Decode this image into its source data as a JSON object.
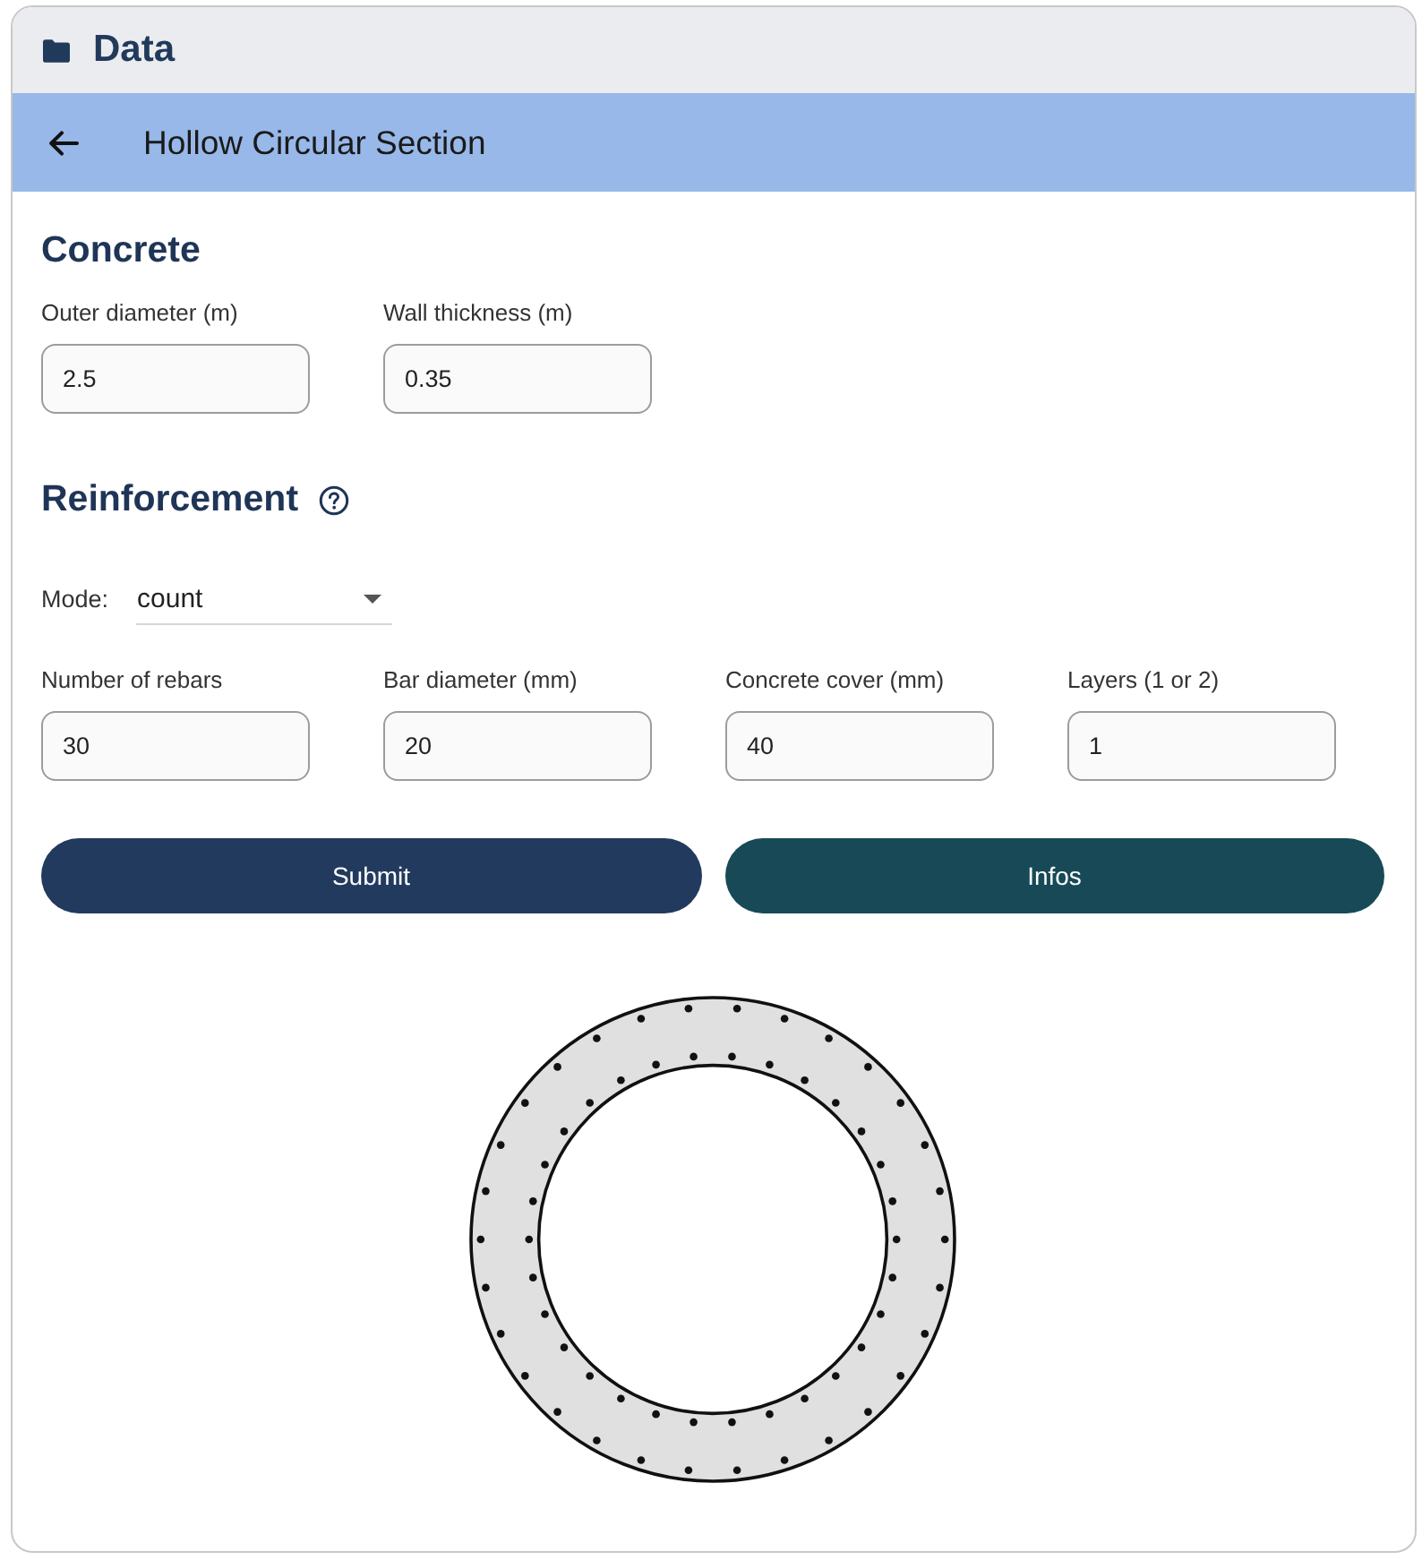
{
  "panel": {
    "title": "Data"
  },
  "app_bar": {
    "title": "Hollow Circular Section"
  },
  "sections": [
    {
      "heading": "Concrete",
      "help": false,
      "fields": [
        {
          "label": "Outer diameter (m)",
          "value": "2.5"
        },
        {
          "label": "Wall thickness (m)",
          "value": "0.35"
        }
      ]
    },
    {
      "heading": "Reinforcement",
      "help": true,
      "mode": {
        "label": "Mode:",
        "value": "count"
      },
      "fields": [
        {
          "label": "Number of rebars",
          "value": "30"
        },
        {
          "label": "Bar diameter (mm)",
          "value": "20"
        },
        {
          "label": "Concrete cover (mm)",
          "value": "40"
        },
        {
          "label": "Layers (1 or 2)",
          "value": "1"
        }
      ]
    }
  ],
  "buttons": [
    {
      "label": "Submit",
      "kind": "primary"
    },
    {
      "label": "Infos",
      "kind": "secondary"
    }
  ]
}
